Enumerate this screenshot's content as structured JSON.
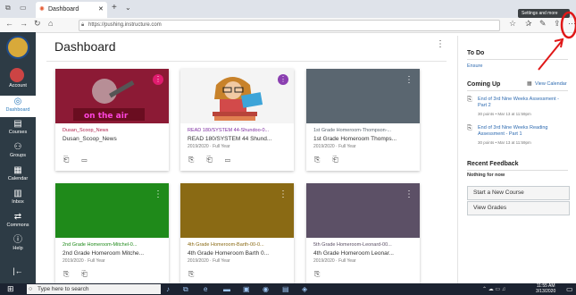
{
  "browser": {
    "tab_title": "Dashboard",
    "new_tab": "+",
    "url": "https://pushing.instructure.com",
    "tooltip": "Settings and more"
  },
  "sidebar": {
    "items": [
      {
        "label": "Account",
        "icon": "account-icon"
      },
      {
        "label": "Dashboard",
        "icon": "dashboard-icon"
      },
      {
        "label": "Courses",
        "icon": "courses-icon"
      },
      {
        "label": "Groups",
        "icon": "groups-icon"
      },
      {
        "label": "Calendar",
        "icon": "calendar-icon"
      },
      {
        "label": "Inbox",
        "icon": "inbox-icon"
      },
      {
        "label": "Commons",
        "icon": "commons-icon"
      },
      {
        "label": "Help",
        "icon": "help-icon"
      }
    ]
  },
  "page": {
    "title": "Dashboard"
  },
  "cards": [
    {
      "short": "Dusan_Scoop_News",
      "name": "Dusan_Scoop_News",
      "term": "",
      "color": "#b01e4a",
      "badge": "#e01c6f"
    },
    {
      "short": "READ 180/SYSTEM 44-Shundoo-0...",
      "name": "READ 180/SYSTEM 44 Shund...",
      "term": "2019/2020 · Full Year",
      "color": "#7d2ca0",
      "badge": "#8a3fb0"
    },
    {
      "short": "1st Grade Homeroom-Thompson-...",
      "name": "1st Grade Homeroom Thomps...",
      "term": "2019/2020 · Full Year",
      "color": "#5a6670",
      "badge": ""
    },
    {
      "short": "2nd Grade Homeroom-Mitchel-0...",
      "name": "2nd Grade Homeroom Mitche...",
      "term": "2019/2020 · Full Year",
      "color": "#1f8a1a",
      "badge": ""
    },
    {
      "short": "4th Grade Homeroom-Barth-00-0...",
      "name": "4th Grade Homeroom Barth 0...",
      "term": "2019/2020 · Full Year",
      "color": "#8a6a14",
      "badge": ""
    },
    {
      "short": "5th Grade Homeroom-Leonard-00...",
      "name": "4th Grade Homeroom Leonar...",
      "term": "2019/2020 · Full Year",
      "color": "#5c5066",
      "badge": ""
    }
  ],
  "right": {
    "todo_title": "To Do",
    "todo_link": "Ensure",
    "coming_up": "Coming Up",
    "view_calendar": "View Calendar",
    "items": [
      {
        "title": "End of 3rd Nine Weeks Assessment - Part 2",
        "meta": "30 points • Mar 13 at 11:59pm"
      },
      {
        "title": "End of 3rd Nine Weeks Reading Assessment - Part 1",
        "meta": "30 points • Mar 13 at 11:59pm"
      }
    ],
    "feedback_title": "Recent Feedback",
    "feedback_text": "Nothing for now",
    "start_course": "Start a New Course",
    "view_grades": "View Grades"
  },
  "taskbar": {
    "search_placeholder": "Type here to search",
    "time": "11:55 AM",
    "date": "3/13/2020"
  },
  "colors": {
    "nav": "#2d3b45",
    "annotation": "#e01818"
  }
}
